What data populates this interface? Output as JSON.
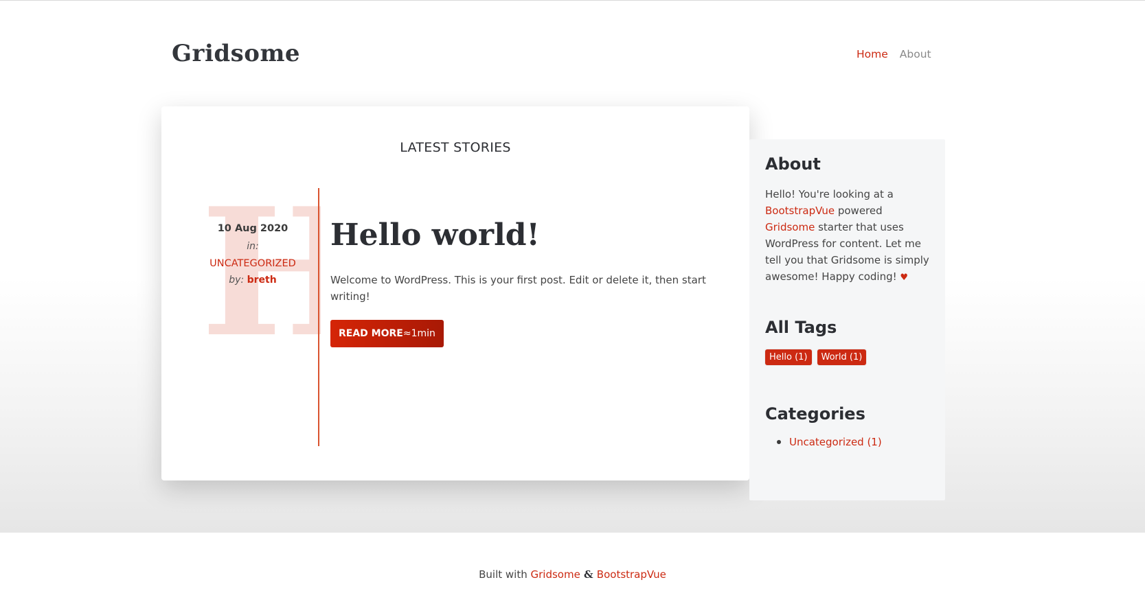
{
  "header": {
    "brand": "Gridsome",
    "nav": [
      {
        "label": "Home"
      },
      {
        "label": "About"
      }
    ]
  },
  "main": {
    "section_title": "LATEST STORIES",
    "post": {
      "title": "Hello world!",
      "initial": "H",
      "date": "10 Aug 2020",
      "in_label": "in:",
      "category": "UNCATEGORIZED",
      "by_label": "by:",
      "author": "breth",
      "excerpt": "Welcome to WordPress. This is your first post. Edit or delete it, then start writing!",
      "read_more_label": "READ MORE",
      "read_time": " ≈1min"
    }
  },
  "sidebar": {
    "about": {
      "heading": "About",
      "text_1": "Hello! You're looking at a ",
      "link_1": "BootstrapVue",
      "text_2": " powered ",
      "link_2": "Gridsome",
      "text_3": " starter that uses WordPress for content. Let me tell you that Gridsome is simply awesome! Happy coding! ",
      "heart": "♥"
    },
    "tags": {
      "heading": "All Tags",
      "items": [
        {
          "label": "Hello (1)"
        },
        {
          "label": "World (1)"
        }
      ]
    },
    "categories": {
      "heading": "Categories",
      "items": [
        {
          "label": "Uncategorized (1)"
        }
      ]
    }
  },
  "footer": {
    "prefix": "Built with ",
    "link_1": "Gridsome",
    "amp": " & ",
    "link_2": "BootstrapVue"
  },
  "colors": {
    "accent": "#cc2a12",
    "heading": "#2c2e33",
    "sidebar_bg": "#f5f6f7",
    "big_letter": "#f7dcd7"
  }
}
